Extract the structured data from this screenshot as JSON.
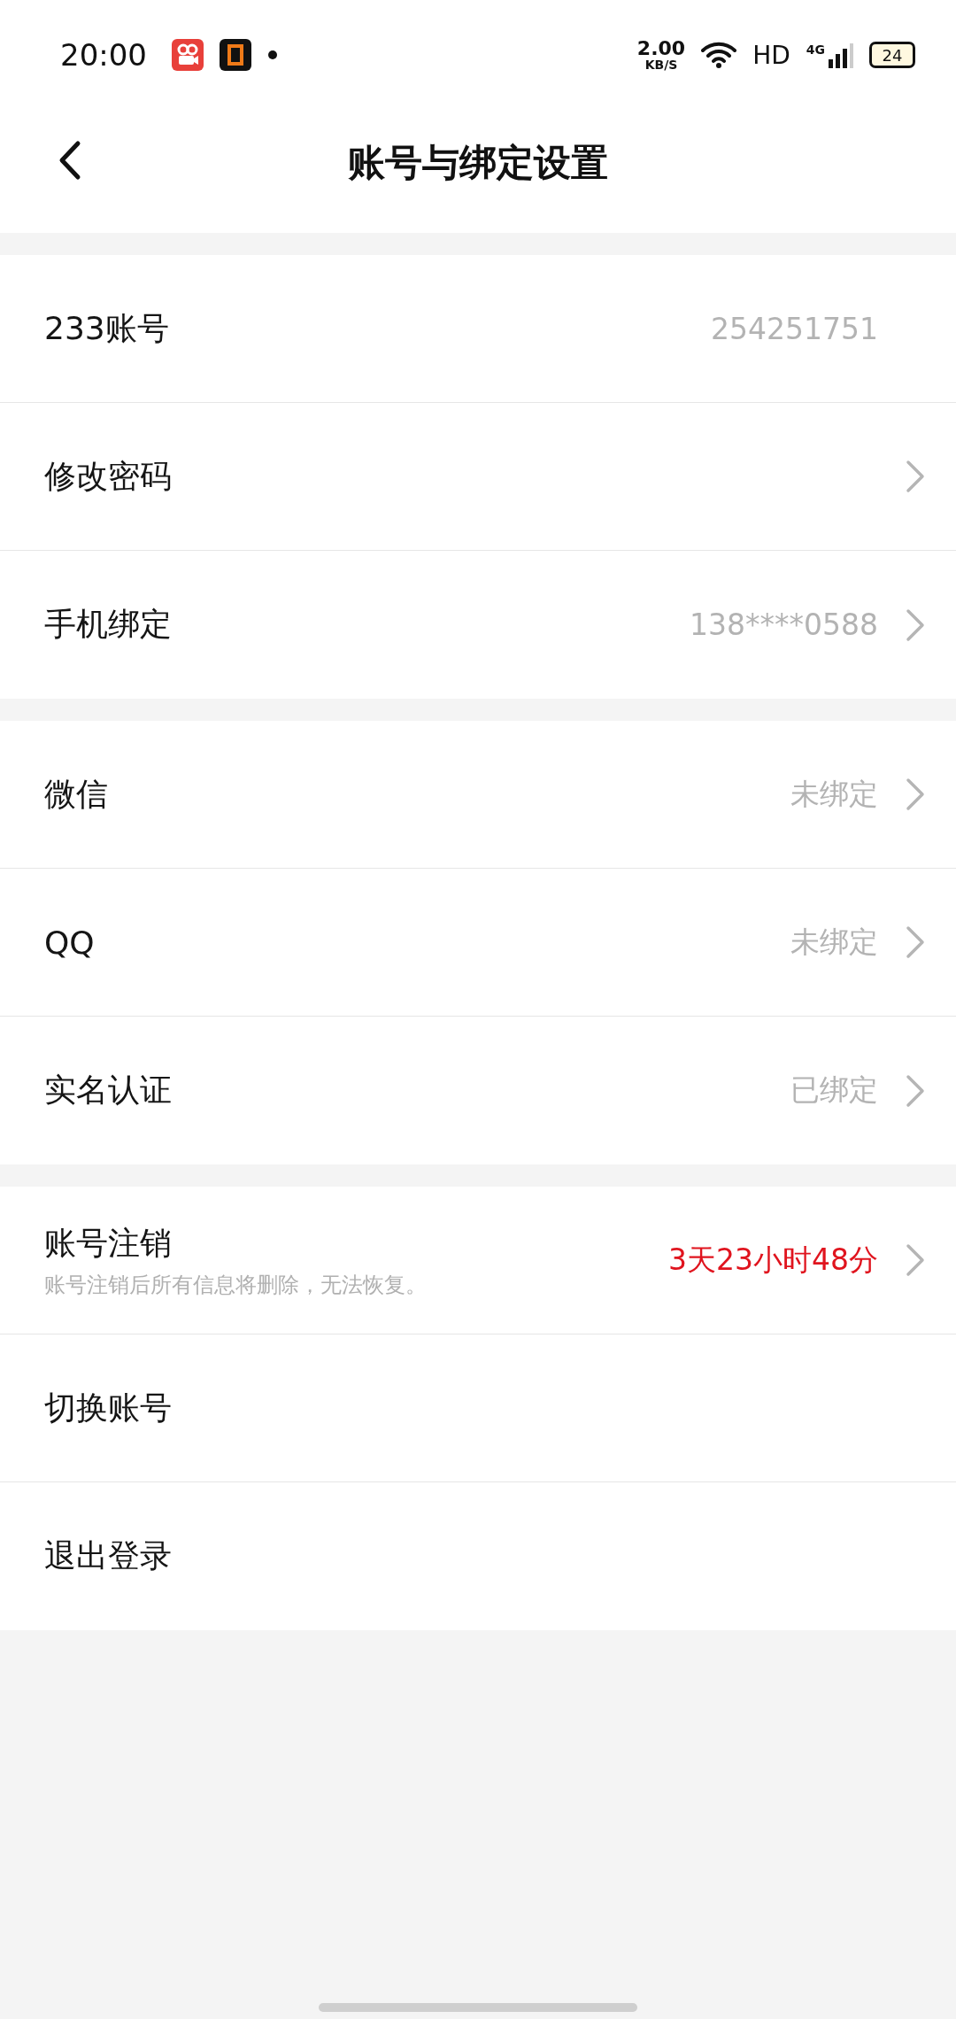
{
  "status_bar": {
    "time": "20:00",
    "net_speed": "2.00",
    "net_unit": "KB/S",
    "network": "HD",
    "cell": "4G",
    "battery": "24"
  },
  "header": {
    "title": "账号与绑定设置"
  },
  "groups": [
    {
      "rows": [
        {
          "kind": "plain",
          "label": "233账号",
          "value": "254251751",
          "chevron": false
        },
        {
          "kind": "plain",
          "label": "修改密码",
          "chevron": true
        },
        {
          "kind": "plain",
          "label": "手机绑定",
          "value": "138****0588",
          "chevron": true
        }
      ]
    },
    {
      "rows": [
        {
          "kind": "plain",
          "label": "微信",
          "value": "未绑定",
          "chevron": true
        },
        {
          "kind": "plain",
          "label": "QQ",
          "value": "未绑定",
          "chevron": true
        },
        {
          "kind": "plain",
          "label": "实名认证",
          "value": "已绑定",
          "chevron": true
        }
      ]
    },
    {
      "rows": [
        {
          "kind": "warning",
          "label": "账号注销",
          "note": "账号注销后所有信息将删除，无法恢复。",
          "value": "3天23小时48分",
          "chevron": true
        },
        {
          "kind": "plain",
          "label": "切换账号",
          "chevron": false
        },
        {
          "kind": "plain",
          "label": "退出登录",
          "chevron": false
        }
      ]
    }
  ]
}
